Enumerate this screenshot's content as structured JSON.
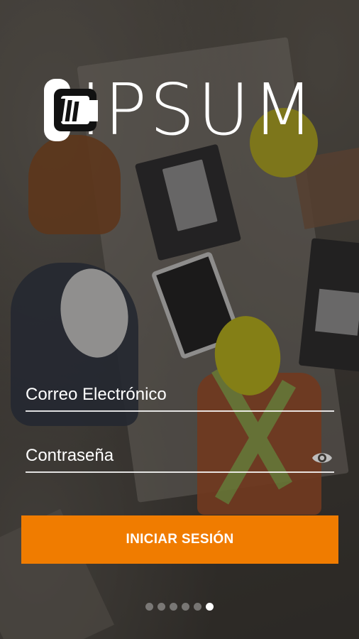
{
  "brand": {
    "name": "IPSUM",
    "icon": "ipsum-logo-icon"
  },
  "form": {
    "email_label": "Correo Electrónico",
    "password_label": "Contraseña",
    "password_toggle_icon": "eye-icon"
  },
  "actions": {
    "login_label": "INICIAR SESIÓN"
  },
  "pager": {
    "total": 6,
    "active_index": 5
  },
  "colors": {
    "accent": "#f07c00",
    "text": "#ffffff"
  }
}
